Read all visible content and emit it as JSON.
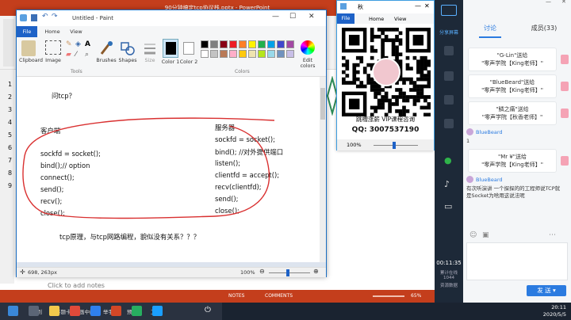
{
  "powerpoint": {
    "title": "90分钟搞定tcp协议栈.pptx - PowerPoint",
    "notes_placeholder": "Click to add notes",
    "status": {
      "notes": "NOTES",
      "comments": "COMMENTS",
      "zoom": "65%"
    },
    "sidebar_nums": [
      "1",
      "2",
      "3",
      "4",
      "5",
      "6",
      "7",
      "8",
      "9"
    ]
  },
  "paint": {
    "title": "Untitled - Paint",
    "tabs": [
      "File",
      "Home",
      "View"
    ],
    "ribbon": {
      "clipboard": "Clipboard",
      "image": "Image",
      "brushes": "Brushes",
      "shapes": "Shapes",
      "size": "Size",
      "color1": "Color 1",
      "color2": "Color 2",
      "edit_colors": "Edit colors",
      "group_tools": "Tools",
      "group_colors": "Colors"
    },
    "palette": [
      "#000000",
      "#7f7f7f",
      "#880015",
      "#ed1c24",
      "#ff7f27",
      "#fff200",
      "#22b14c",
      "#00a2e8",
      "#3f48cc",
      "#a349a4",
      "#ffffff",
      "#c3c3c3",
      "#b97a57",
      "#ffaec9",
      "#ffc90e",
      "#efe4b0",
      "#b5e61d",
      "#99d9ea",
      "#7092be",
      "#c8bfe7"
    ],
    "canvas": {
      "heading": "问tcp？",
      "client_title": "客户端",
      "client_lines": [
        "sockfd = socket();",
        "bind();// option",
        "connect();",
        "send();",
        "recv();",
        "close();"
      ],
      "server_title": "服务器",
      "server_lines": [
        "sockfd = socket();",
        "bind(); //对外提供端口",
        "listen();",
        "clientfd = accept();",
        "recv(clientfd);",
        "send();",
        "close();"
      ],
      "question": "tcp原理，与tcp网路编程，貌似没有关系？？？"
    },
    "status": {
      "coords": "698, 263px",
      "zoom": "100%"
    }
  },
  "qq": {
    "title": "秋",
    "tabs": [
      "File",
      "Home",
      "View"
    ],
    "caption": "跳槽涨薪 VIP课程咨询",
    "qq_number": "QQ: 3007537190",
    "zoom": "100%"
  },
  "side": {
    "share_label": "分享屏幕",
    "time": "00:11:35",
    "stats1": "累计在线",
    "stats2": "1044",
    "stats3": "资源数据"
  },
  "chat": {
    "tab_discuss": "讨论",
    "tab_members": "成员(33)",
    "messages": [
      {
        "type": "gift",
        "from": "\"G-Lin\"送给",
        "to": "\"零声学院【King老师】\""
      },
      {
        "type": "gift",
        "from": "\"BlueBeard\"送给",
        "to": "\"零声学院【King老师】\""
      },
      {
        "type": "gift",
        "from": "\"鳞之痛\"送给",
        "to": "\"零声学院【秋香老师】\""
      },
      {
        "type": "user",
        "user": "BlueBeard",
        "text": "1"
      },
      {
        "type": "gift",
        "from": "\"Mr ¥\"送给",
        "to": "\"零声学院【King老师】\""
      },
      {
        "type": "user",
        "user": "BlueBeard",
        "text": "有次听演讲 一个探探的的工程师说TCP就是Socket为啥用这说法呢"
      }
    ],
    "send_button": "发 送"
  },
  "taskbar": {
    "items": [
      "面板",
      "签到",
      "答题卡",
      "画中画",
      "举手",
      "预览",
      "工具"
    ],
    "time": "20:11",
    "date": "2020/5/5"
  }
}
